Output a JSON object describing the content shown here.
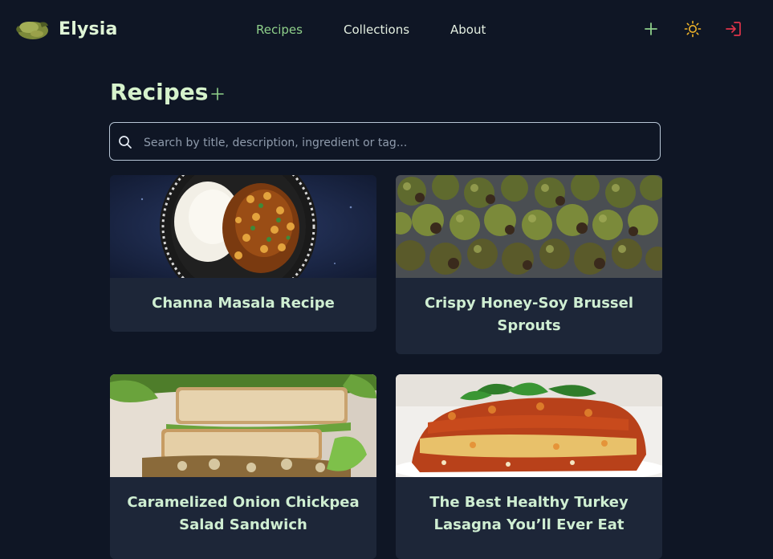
{
  "brand": {
    "name": "Elysia"
  },
  "nav": {
    "recipes": "Recipes",
    "collections": "Collections",
    "about": "About"
  },
  "header_icons": [
    "plus-icon",
    "sun-icon",
    "login-icon"
  ],
  "page": {
    "title": "Recipes"
  },
  "search": {
    "placeholder": "Search by title, description, ingredient or tag..."
  },
  "recipes": [
    {
      "title": "Channa Masala Recipe"
    },
    {
      "title": "Crispy Honey-Soy Brussel Sprouts"
    },
    {
      "title": "Caramelized Onion Chickpea Salad Sandwich"
    },
    {
      "title": "The Best Healthy Turkey Lasagna You’ll Ever Eat"
    }
  ],
  "colors": {
    "background": "#0f1625",
    "card": "#1d2638",
    "accent": "#8fd08a",
    "sun": "#f0b429",
    "login": "#e0344a"
  }
}
